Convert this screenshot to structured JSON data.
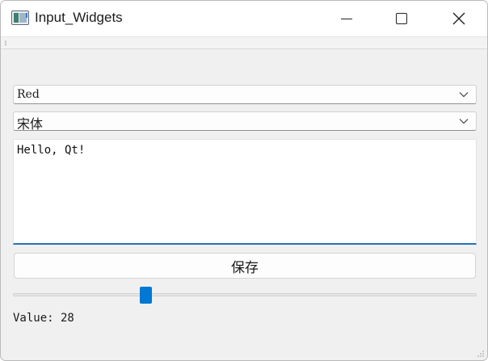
{
  "window": {
    "title": "Input_Widgets",
    "icons": {
      "app": "app-window-icon",
      "minimize": "minimize-icon",
      "maximize": "maximize-icon",
      "close": "close-icon"
    }
  },
  "color_combo": {
    "selected": "Red",
    "icon": "chevron-down-icon"
  },
  "font_combo": {
    "selected": "宋体",
    "icon": "chevron-down-icon"
  },
  "text_edit": {
    "value": "Hello, Qt!"
  },
  "save_button": {
    "label": "保存"
  },
  "slider": {
    "value": 28,
    "min": 0,
    "max": 100
  },
  "value_label": {
    "text": "Value: 28"
  },
  "colors": {
    "accent": "#0078d4",
    "focus_underline": "#2473b8",
    "window_bg": "#f0f0f0"
  }
}
